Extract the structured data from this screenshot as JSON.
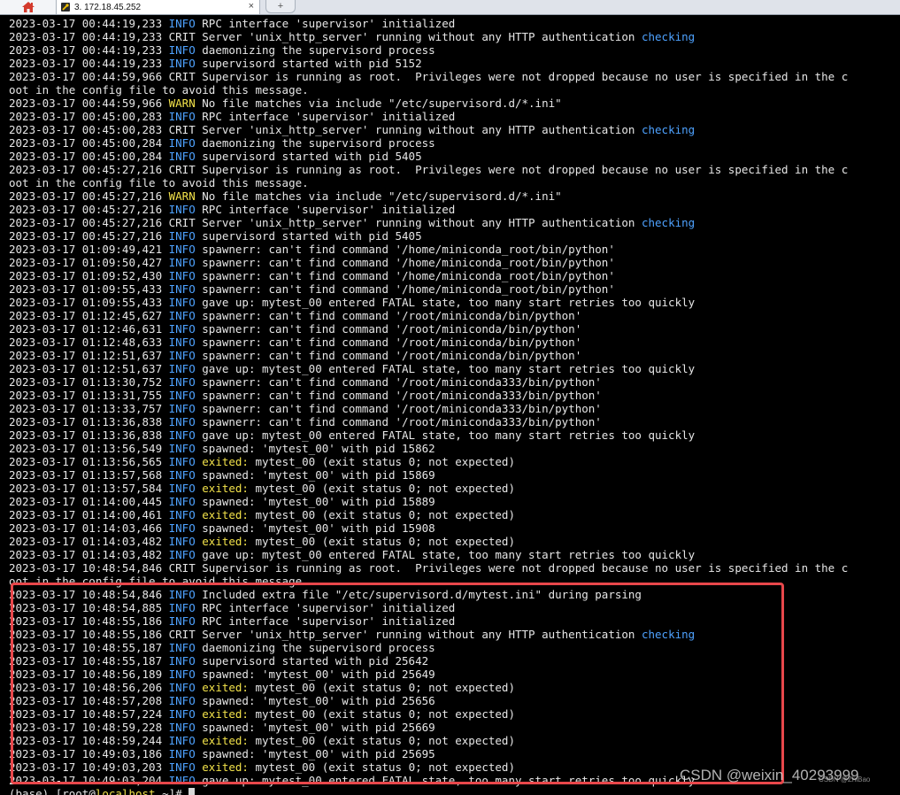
{
  "tabs": {
    "home_icon": "home-icon",
    "session_label": "3. 172.18.45.252",
    "session_icon": "key-wrench-icon",
    "close_glyph": "×",
    "new_tab_glyph": "+"
  },
  "colors": {
    "background": "#000000",
    "text": "#e6e6e6",
    "info": "#4ea2ff",
    "warn": "#f2e24a",
    "highlight_border": "#e8474b"
  },
  "log_lines": [
    {
      "ts": "2023-03-17 00:44:19,233",
      "level": "INFO",
      "msg": "RPC interface 'supervisor' initialized"
    },
    {
      "ts": "2023-03-17 00:44:19,233",
      "level": "CRIT",
      "msg": "Server 'unix_http_server' running without any HTTP authentication checking"
    },
    {
      "ts": "2023-03-17 00:44:19,233",
      "level": "INFO",
      "msg": "daemonizing the supervisord process"
    },
    {
      "ts": "2023-03-17 00:44:19,233",
      "level": "INFO",
      "msg": "supervisord started with pid 5152"
    },
    {
      "ts": "2023-03-17 00:44:59,966",
      "level": "CRIT",
      "msg": "Supervisor is running as root.  Privileges were not dropped because no user is specified in the c"
    },
    {
      "text": "oot in the config file to avoid this message."
    },
    {
      "ts": "2023-03-17 00:44:59,966",
      "level": "WARN",
      "msg": "No file matches via include \"/etc/supervisord.d/*.ini\""
    },
    {
      "ts": "2023-03-17 00:45:00,283",
      "level": "INFO",
      "msg": "RPC interface 'supervisor' initialized"
    },
    {
      "ts": "2023-03-17 00:45:00,283",
      "level": "CRIT",
      "msg": "Server 'unix_http_server' running without any HTTP authentication checking"
    },
    {
      "ts": "2023-03-17 00:45:00,284",
      "level": "INFO",
      "msg": "daemonizing the supervisord process"
    },
    {
      "ts": "2023-03-17 00:45:00,284",
      "level": "INFO",
      "msg": "supervisord started with pid 5405"
    },
    {
      "ts": "2023-03-17 00:45:27,216",
      "level": "CRIT",
      "msg": "Supervisor is running as root.  Privileges were not dropped because no user is specified in the c"
    },
    {
      "text": "oot in the config file to avoid this message."
    },
    {
      "ts": "2023-03-17 00:45:27,216",
      "level": "WARN",
      "msg": "No file matches via include \"/etc/supervisord.d/*.ini\""
    },
    {
      "ts": "2023-03-17 00:45:27,216",
      "level": "INFO",
      "msg": "RPC interface 'supervisor' initialized"
    },
    {
      "ts": "2023-03-17 00:45:27,216",
      "level": "CRIT",
      "msg": "Server 'unix_http_server' running without any HTTP authentication checking"
    },
    {
      "ts": "2023-03-17 00:45:27,216",
      "level": "INFO",
      "msg": "supervisord started with pid 5405"
    },
    {
      "ts": "2023-03-17 01:09:49,421",
      "level": "INFO",
      "msg": "spawnerr: can't find command '/home/miniconda_root/bin/python'"
    },
    {
      "ts": "2023-03-17 01:09:50,427",
      "level": "INFO",
      "msg": "spawnerr: can't find command '/home/miniconda_root/bin/python'"
    },
    {
      "ts": "2023-03-17 01:09:52,430",
      "level": "INFO",
      "msg": "spawnerr: can't find command '/home/miniconda_root/bin/python'"
    },
    {
      "ts": "2023-03-17 01:09:55,433",
      "level": "INFO",
      "msg": "spawnerr: can't find command '/home/miniconda_root/bin/python'"
    },
    {
      "ts": "2023-03-17 01:09:55,433",
      "level": "INFO",
      "msg": "gave up: mytest_00 entered FATAL state, too many start retries too quickly"
    },
    {
      "ts": "2023-03-17 01:12:45,627",
      "level": "INFO",
      "msg": "spawnerr: can't find command '/root/miniconda/bin/python'"
    },
    {
      "ts": "2023-03-17 01:12:46,631",
      "level": "INFO",
      "msg": "spawnerr: can't find command '/root/miniconda/bin/python'"
    },
    {
      "ts": "2023-03-17 01:12:48,633",
      "level": "INFO",
      "msg": "spawnerr: can't find command '/root/miniconda/bin/python'"
    },
    {
      "ts": "2023-03-17 01:12:51,637",
      "level": "INFO",
      "msg": "spawnerr: can't find command '/root/miniconda/bin/python'"
    },
    {
      "ts": "2023-03-17 01:12:51,637",
      "level": "INFO",
      "msg": "gave up: mytest_00 entered FATAL state, too many start retries too quickly"
    },
    {
      "ts": "2023-03-17 01:13:30,752",
      "level": "INFO",
      "msg": "spawnerr: can't find command '/root/miniconda333/bin/python'"
    },
    {
      "ts": "2023-03-17 01:13:31,755",
      "level": "INFO",
      "msg": "spawnerr: can't find command '/root/miniconda333/bin/python'"
    },
    {
      "ts": "2023-03-17 01:13:33,757",
      "level": "INFO",
      "msg": "spawnerr: can't find command '/root/miniconda333/bin/python'"
    },
    {
      "ts": "2023-03-17 01:13:36,838",
      "level": "INFO",
      "msg": "spawnerr: can't find command '/root/miniconda333/bin/python'"
    },
    {
      "ts": "2023-03-17 01:13:36,838",
      "level": "INFO",
      "msg": "gave up: mytest_00 entered FATAL state, too many start retries too quickly"
    },
    {
      "ts": "2023-03-17 01:13:56,549",
      "level": "INFO",
      "msg": "spawned: 'mytest_00' with pid 15862"
    },
    {
      "ts": "2023-03-17 01:13:56,565",
      "level": "INFO",
      "msg": "exited: mytest_00 (exit status 0; not expected)"
    },
    {
      "ts": "2023-03-17 01:13:57,568",
      "level": "INFO",
      "msg": "spawned: 'mytest_00' with pid 15869"
    },
    {
      "ts": "2023-03-17 01:13:57,584",
      "level": "INFO",
      "msg": "exited: mytest_00 (exit status 0; not expected)"
    },
    {
      "ts": "2023-03-17 01:14:00,445",
      "level": "INFO",
      "msg": "spawned: 'mytest_00' with pid 15889"
    },
    {
      "ts": "2023-03-17 01:14:00,461",
      "level": "INFO",
      "msg": "exited: mytest_00 (exit status 0; not expected)"
    },
    {
      "ts": "2023-03-17 01:14:03,466",
      "level": "INFO",
      "msg": "spawned: 'mytest_00' with pid 15908"
    },
    {
      "ts": "2023-03-17 01:14:03,482",
      "level": "INFO",
      "msg": "exited: mytest_00 (exit status 0; not expected)"
    },
    {
      "ts": "2023-03-17 01:14:03,482",
      "level": "INFO",
      "msg": "gave up: mytest_00 entered FATAL state, too many start retries too quickly"
    },
    {
      "ts": "2023-03-17 10:48:54,846",
      "level": "CRIT",
      "msg": "Supervisor is running as root.  Privileges were not dropped because no user is specified in the c"
    },
    {
      "text": "oot in the config file to avoid this message."
    },
    {
      "ts": "2023-03-17 10:48:54,846",
      "level": "INFO",
      "msg": "Included extra file \"/etc/supervisord.d/mytest.ini\" during parsing"
    },
    {
      "ts": "2023-03-17 10:48:54,885",
      "level": "INFO",
      "msg": "RPC interface 'supervisor' initialized"
    },
    {
      "ts": "2023-03-17 10:48:55,186",
      "level": "INFO",
      "msg": "RPC interface 'supervisor' initialized"
    },
    {
      "ts": "2023-03-17 10:48:55,186",
      "level": "CRIT",
      "msg": "Server 'unix_http_server' running without any HTTP authentication checking"
    },
    {
      "ts": "2023-03-17 10:48:55,187",
      "level": "INFO",
      "msg": "daemonizing the supervisord process"
    },
    {
      "ts": "2023-03-17 10:48:55,187",
      "level": "INFO",
      "msg": "supervisord started with pid 25642"
    },
    {
      "ts": "2023-03-17 10:48:56,189",
      "level": "INFO",
      "msg": "spawned: 'mytest_00' with pid 25649"
    },
    {
      "ts": "2023-03-17 10:48:56,206",
      "level": "INFO",
      "msg": "exited: mytest_00 (exit status 0; not expected)"
    },
    {
      "ts": "2023-03-17 10:48:57,208",
      "level": "INFO",
      "msg": "spawned: 'mytest_00' with pid 25656"
    },
    {
      "ts": "2023-03-17 10:48:57,224",
      "level": "INFO",
      "msg": "exited: mytest_00 (exit status 0; not expected)"
    },
    {
      "ts": "2023-03-17 10:48:59,228",
      "level": "INFO",
      "msg": "spawned: 'mytest_00' with pid 25669"
    },
    {
      "ts": "2023-03-17 10:48:59,244",
      "level": "INFO",
      "msg": "exited: mytest_00 (exit status 0; not expected)"
    },
    {
      "ts": "2023-03-17 10:49:03,186",
      "level": "INFO",
      "msg": "spawned: 'mytest_00' with pid 25695"
    },
    {
      "ts": "2023-03-17 10:49:03,203",
      "level": "INFO",
      "msg": "exited: mytest_00 (exit status 0; not expected)"
    },
    {
      "ts": "2023-03-17 10:49:03,204",
      "level": "INFO",
      "msg": "gave up: mytest_00 entered FATAL state, too many start retries too quickly"
    }
  ],
  "prompt": {
    "env": "(base) ",
    "user": "[root@",
    "host": "localhost",
    "path": " ~]# "
  },
  "watermark": {
    "text": "CSDN @weixin_40293999",
    "small": "CSDN @ZhiBao"
  }
}
